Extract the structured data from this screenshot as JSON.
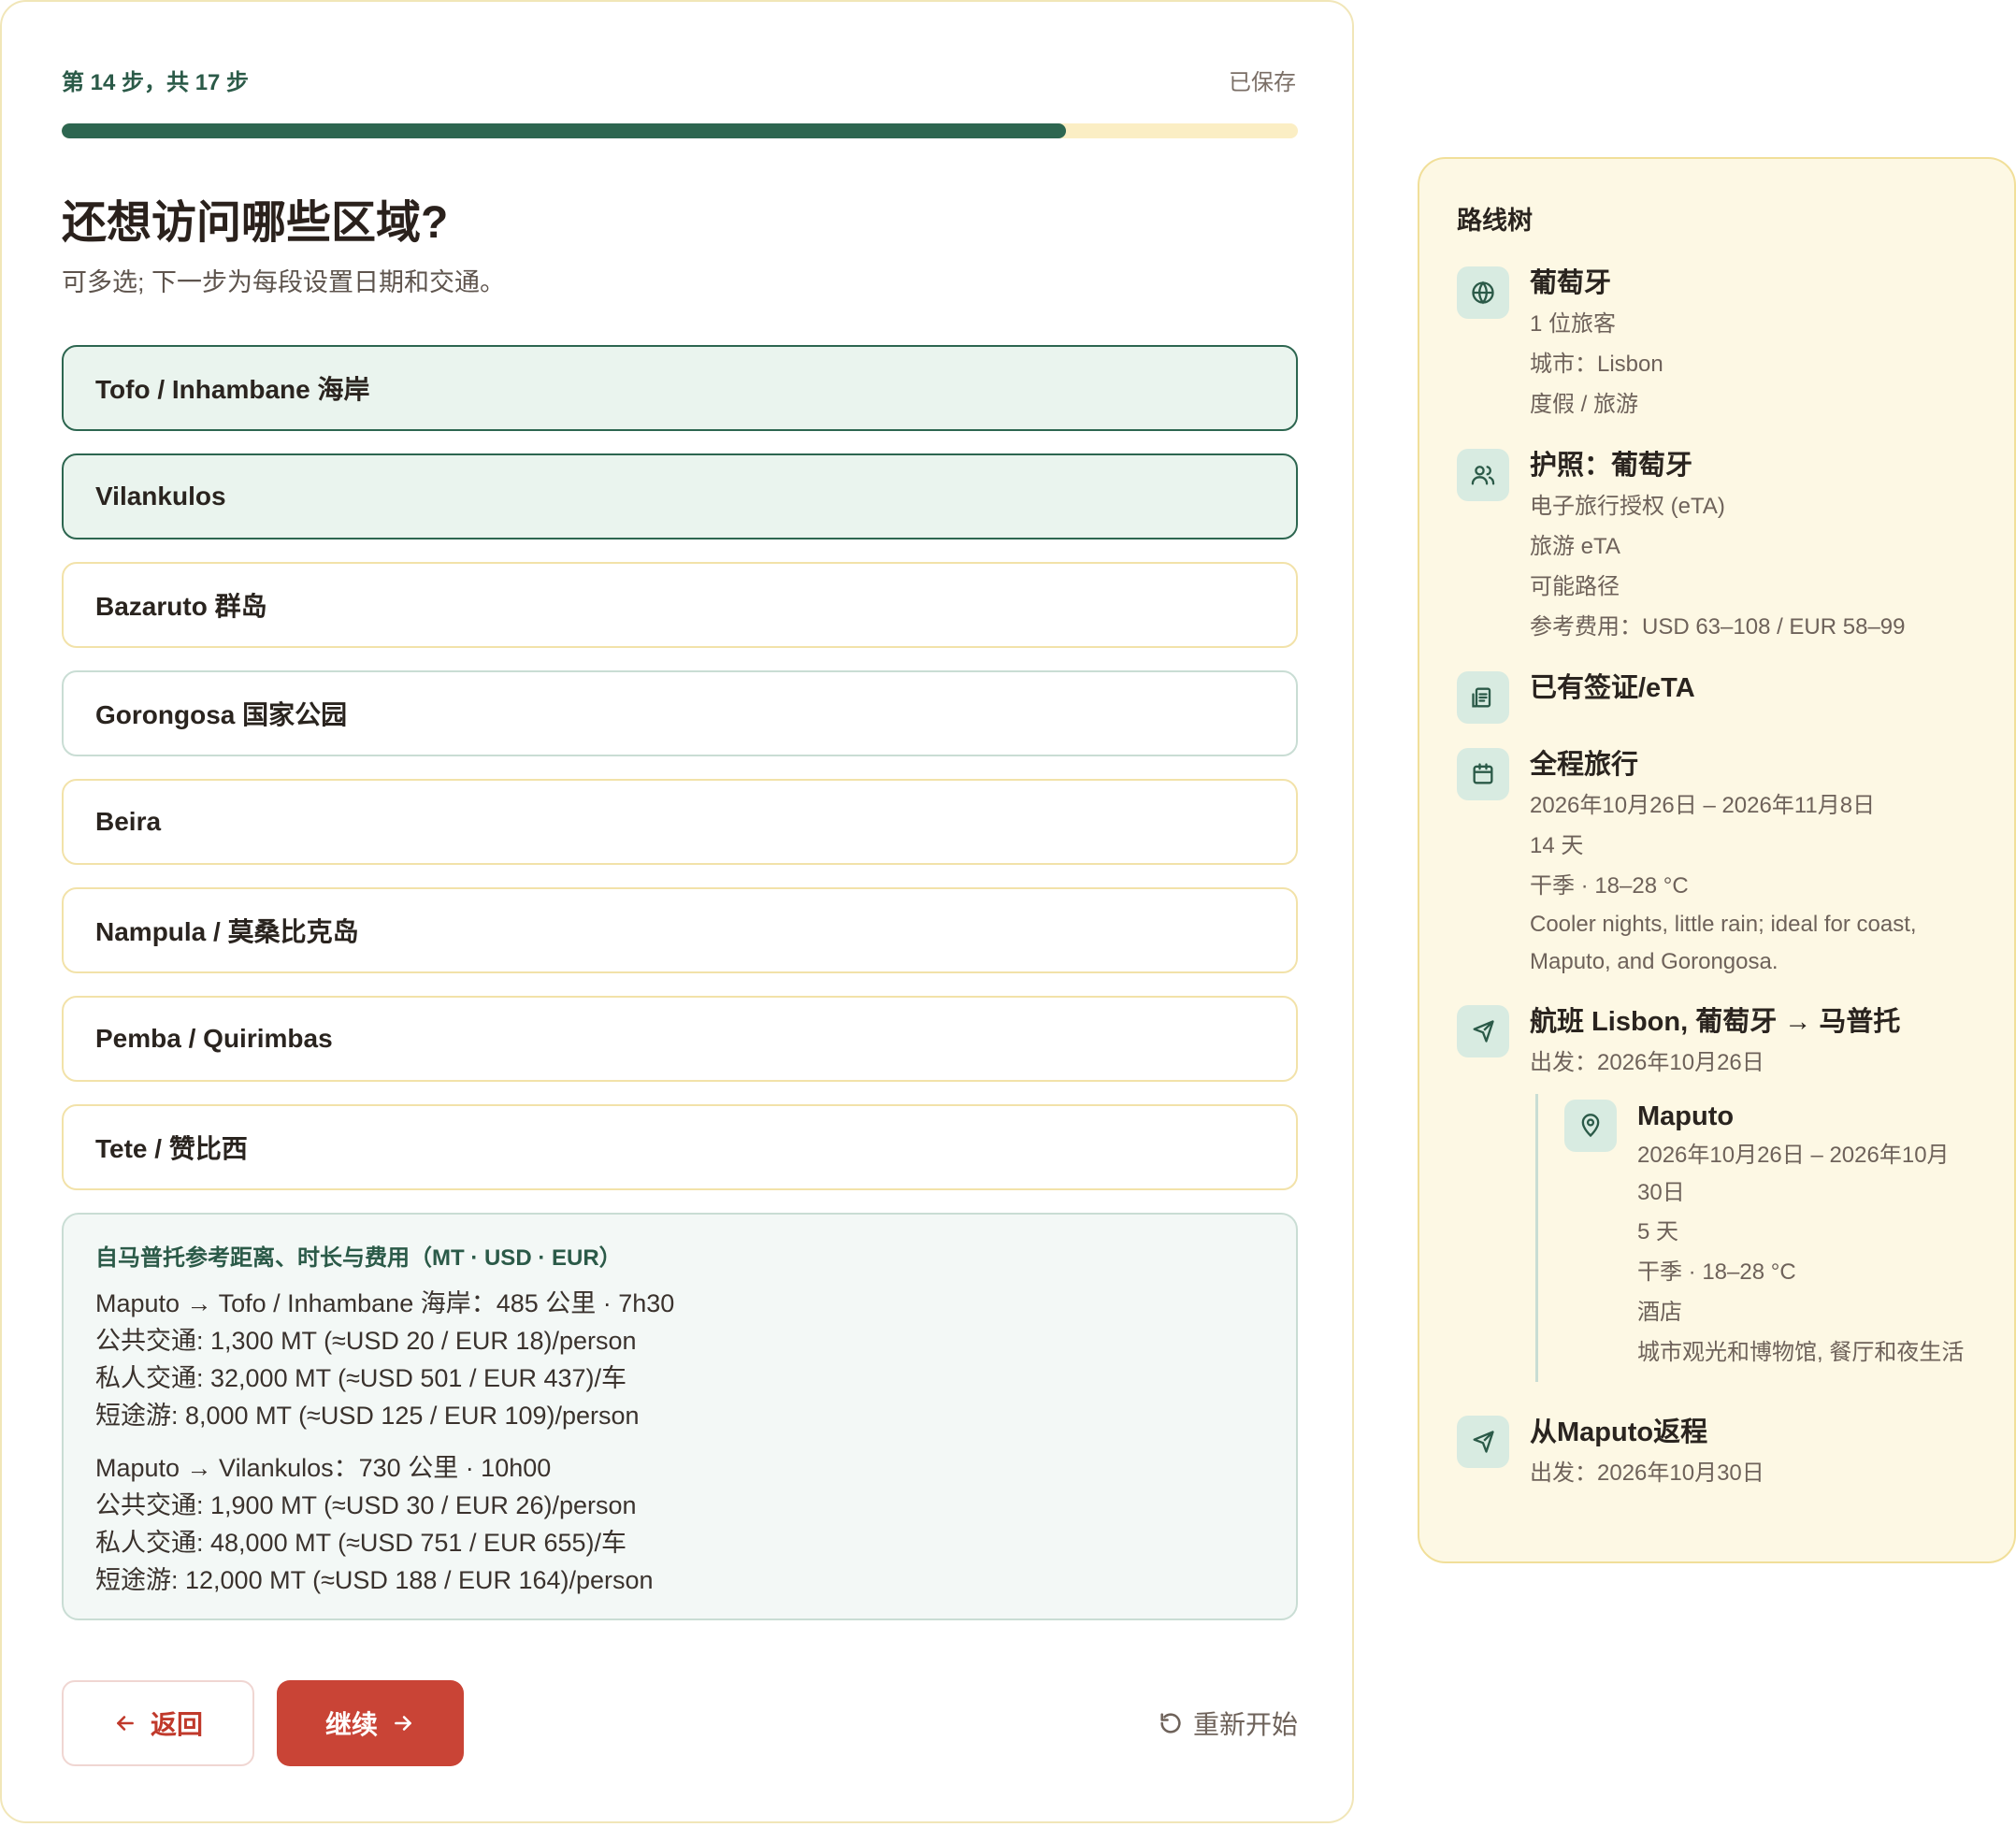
{
  "progress": {
    "step_label": "第 14 步，共 17 步",
    "saved": "已保存",
    "fraction": 0.8125
  },
  "question": {
    "title": "还想访问哪些区域?",
    "subtitle": "可多选; 下一步为每段设置日期和交通。"
  },
  "options": [
    {
      "label": "Tofo / Inhambane 海岸",
      "selected": true
    },
    {
      "label": "Vilankulos",
      "selected": true
    },
    {
      "label": "Bazaruto 群岛",
      "selected": false
    },
    {
      "label": "Gorongosa 国家公园",
      "selected": false
    },
    {
      "label": "Beira",
      "selected": false
    },
    {
      "label": "Nampula / 莫桑比克岛",
      "selected": false
    },
    {
      "label": "Pemba / Quirimbas",
      "selected": false
    },
    {
      "label": "Tete / 赞比西",
      "selected": false
    }
  ],
  "info": {
    "title": "自马普托参考距离、时长与费用（MT · USD · EUR）",
    "routes": [
      {
        "head": "Maputo → Tofo / Inhambane 海岸：485 公里 · 7h30",
        "public": "公共交通: 1,300 MT (≈USD 20 / EUR 18)/person",
        "private": "私人交通: 32,000 MT (≈USD 501 / EUR 437)/车",
        "tour": "短途游: 8,000 MT (≈USD 125 / EUR 109)/person"
      },
      {
        "head": "Maputo → Vilankulos：730 公里 · 10h00",
        "public": "公共交通: 1,900 MT (≈USD 30 / EUR 26)/person",
        "private": "私人交通: 48,000 MT (≈USD 751 / EUR 655)/车",
        "tour": "短途游: 12,000 MT (≈USD 188 / EUR 164)/person"
      }
    ]
  },
  "buttons": {
    "back": "返回",
    "continue": "继续",
    "restart": "重新开始"
  },
  "side": {
    "title": "路线树",
    "country": {
      "head": "葡萄牙",
      "travelers": "1 位旅客",
      "city": "城市：Lisbon",
      "purpose": "度假 / 旅游"
    },
    "passport": {
      "head": "护照：葡萄牙",
      "visa_type": "电子旅行授权 (eTA)",
      "visa_kind": "旅游 eTA",
      "path": "可能路径",
      "fee": "参考费用：USD 63–108 / EUR 58–99"
    },
    "existing": {
      "head": "已有签证/eTA"
    },
    "trip": {
      "head": "全程旅行",
      "dates": "2026年10月26日 – 2026年11月8日",
      "days": "14 天",
      "season": "干季 · 18–28 °C",
      "note": "Cooler nights, little rain; ideal for coast, Maputo, and Gorongosa."
    },
    "flight_out": {
      "head": "航班 Lisbon, 葡萄牙 → 马普托",
      "depart": "出发：2026年10月26日"
    },
    "stop": {
      "head": "Maputo",
      "dates": "2026年10月26日 – 2026年10月30日",
      "days": "5 天",
      "season": "干季 · 18–28 °C",
      "lodging": "酒店",
      "activities": "城市观光和博物馆, 餐厅和夜生活"
    },
    "flight_back": {
      "head": "从Maputo返程",
      "depart": "出发：2026年10月30日"
    }
  },
  "colors": {
    "accent_green": "#2d6650",
    "accent_red": "#c94436",
    "panel_bg": "#fdf8e4"
  }
}
